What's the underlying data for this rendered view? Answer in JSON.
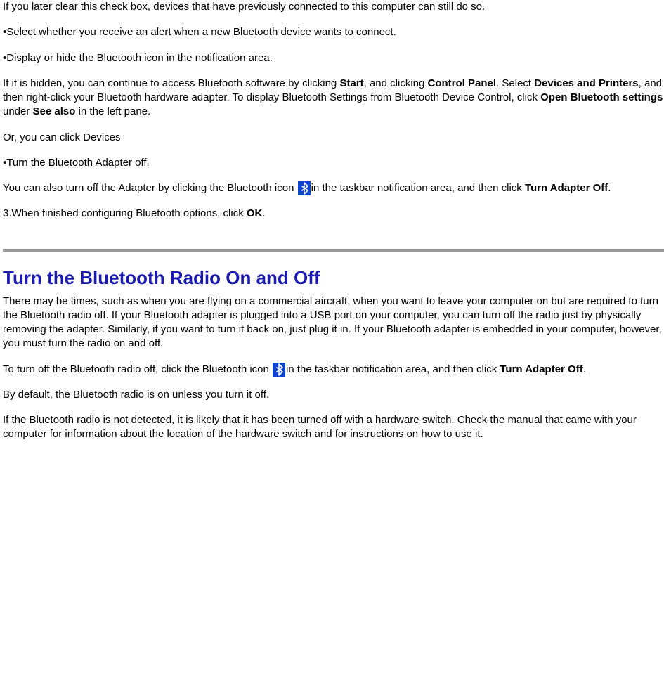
{
  "p1": "If you later clear this check box, devices that have previously connected to this computer can still do so.",
  "p2": "•Select whether you receive an alert when a new Bluetooth device wants to connect.",
  "p3": "•Display or hide the Bluetooth icon in the notification area.",
  "p4_a": "If it is hidden, you can continue to access Bluetooth software by clicking ",
  "p4_b_start": "Start",
  "p4_c": ", and clicking ",
  "p4_b_cp": "Control Panel",
  "p4_d": ". Select ",
  "p4_b_dp": "Devices and Printers",
  "p4_e": ", and then right-click your Bluetooth hardware adapter. To display Bluetooth Settings from Bluetooth Device Control, click ",
  "p4_b_obs": "Open Bluetooth settings",
  "p4_f": " under ",
  "p4_b_sa": "See also",
  "p4_g": " in the left pane.",
  "p5": "Or, you can click Devices",
  "p6": "•Turn the Bluetooth Adapter off.",
  "p7_a": "You can also turn off the Adapter by clicking the Bluetooth icon ",
  "p7_b": "in the taskbar notification area, and then click ",
  "p7_b_tao": "Turn Adapter Off",
  "p7_c": ".",
  "p8_a": "3.When finished configuring Bluetooth options, click ",
  "p8_b_ok": "OK",
  "p8_c": ".",
  "h2": "Turn the Bluetooth Radio On and Off",
  "p9": "There may be times, such as when you are flying on a commercial aircraft, when you want to leave your computer on but are required to turn the Bluetooth radio off. If your Bluetooth adapter is plugged into a USB port on your computer, you can turn off the radio just by physically removing the adapter. Similarly, if you want to turn it back on, just plug it in. If your Bluetooth adapter is embedded in your computer, however, you must turn the radio on and off.",
  "p10_a": "To turn off the Bluetooth radio off, click the Bluetooth icon ",
  "p10_b": "in the taskbar notification area, and then click ",
  "p10_b_tao": "Turn Adapter Off",
  "p10_c": ".",
  "p11": "By default, the Bluetooth radio is on unless you turn it off.",
  "p12": "If the Bluetooth radio is not detected, it is likely that it has been turned off with a hardware switch. Check the manual that came with your computer for information about the location of the hardware switch and for instructions on how to use it."
}
